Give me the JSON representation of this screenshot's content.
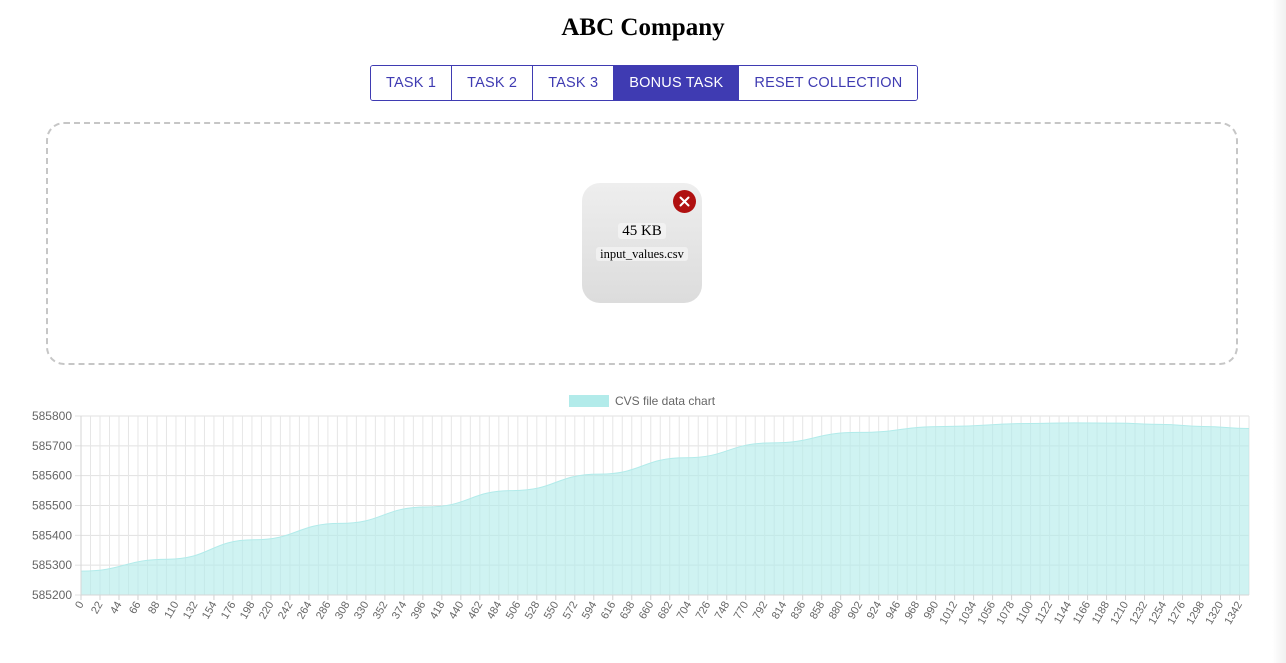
{
  "page": {
    "title": "ABC Company"
  },
  "tabs": [
    {
      "label": "TASK 1",
      "active": false
    },
    {
      "label": "TASK 2",
      "active": false
    },
    {
      "label": "TASK 3",
      "active": false
    },
    {
      "label": "BONUS TASK",
      "active": true
    },
    {
      "label": "RESET COLLECTION",
      "active": false
    }
  ],
  "upload": {
    "file_size": "45 KB",
    "file_name": "input_values.csv",
    "remove_icon": "close-icon"
  },
  "colors": {
    "accent": "#3f3bb2",
    "remove": "#b01010",
    "series_fill": "#b2ebea",
    "series_line": "#b2ebea"
  },
  "chart_data": {
    "type": "area",
    "legend": {
      "label": "CVS file data chart",
      "position": "top"
    },
    "x_start": 0,
    "x_end": 1353,
    "x_tick_step": 22,
    "ylim": [
      585200,
      585800
    ],
    "y_ticks": [
      585200,
      585300,
      585400,
      585500,
      585600,
      585700,
      585800
    ],
    "grid": true,
    "series": [
      {
        "name": "CVS file data chart",
        "x": [
          0,
          100,
          200,
          300,
          400,
          500,
          600,
          700,
          800,
          900,
          1000,
          1100,
          1150,
          1200,
          1250,
          1300,
          1353
        ],
        "y": [
          585280,
          585320,
          585385,
          585440,
          585495,
          585550,
          585605,
          585660,
          585710,
          585745,
          585765,
          585775,
          585777,
          585776,
          585772,
          585765,
          585758
        ]
      }
    ]
  }
}
